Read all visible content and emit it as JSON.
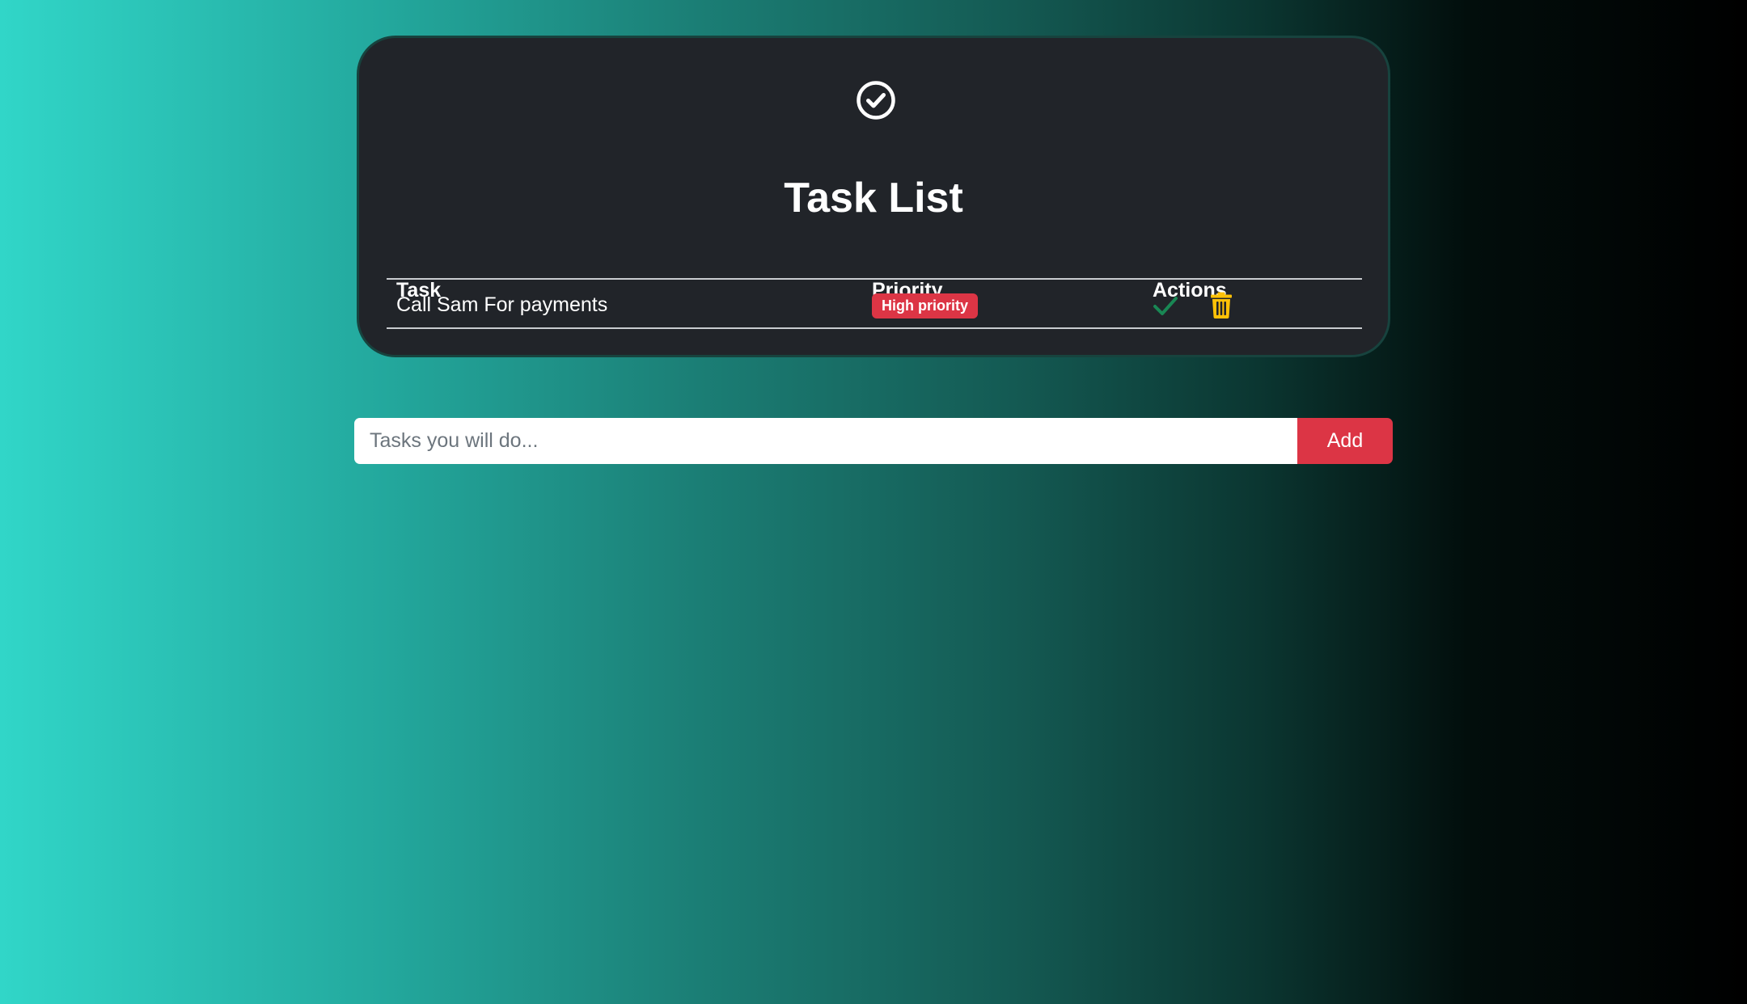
{
  "header": {
    "icon": "check-circle-icon",
    "title": "Task List"
  },
  "table": {
    "columns": [
      "Task",
      "Priority",
      "Actions"
    ],
    "rows": [
      {
        "task": "Call Sam For payments",
        "priority": "High priority",
        "actions": [
          "check-icon",
          "trash-icon"
        ]
      }
    ]
  },
  "new_task": {
    "placeholder": "Tasks you will do...",
    "value": "",
    "add_label": "Add"
  },
  "colors": {
    "card_bg": "#212429",
    "danger": "#dc3545",
    "success": "#198754",
    "warning": "#ffc107",
    "gradient_start": "#31d6c8",
    "gradient_end": "#000000"
  }
}
